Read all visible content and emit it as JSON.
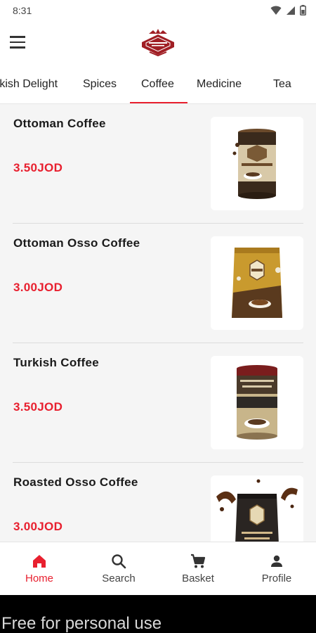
{
  "status_bar": {
    "time": "8:31"
  },
  "header": {
    "logo_icon": "brand-logo"
  },
  "tabs": [
    {
      "label": "rkish Delight"
    },
    {
      "label": "Spices"
    },
    {
      "label": "Coffee",
      "active": true
    },
    {
      "label": "Medicine"
    },
    {
      "label": "Tea"
    }
  ],
  "products": [
    {
      "name": "Ottoman Coffee",
      "price": "3.50JOD",
      "image_icon": "coffee-tin-icon"
    },
    {
      "name": "Ottoman Osso Coffee",
      "price": "3.00JOD",
      "image_icon": "coffee-pouch-icon"
    },
    {
      "name": "Turkish Coffee",
      "price": "3.50JOD",
      "image_icon": "coffee-tin-icon"
    },
    {
      "name": "Roasted Osso Coffee",
      "price": "3.00JOD",
      "image_icon": "coffee-pouch-icon"
    }
  ],
  "bottom_nav": [
    {
      "label": "Home",
      "icon": "home-icon",
      "active": true
    },
    {
      "label": "Search",
      "icon": "search-icon"
    },
    {
      "label": "Basket",
      "icon": "cart-icon"
    },
    {
      "label": "Profile",
      "icon": "person-icon"
    }
  ],
  "watermark": {
    "text": "Free for personal use"
  },
  "colors": {
    "accent": "#e8202f",
    "background": "#f5f5f5",
    "logo": "#a01e24"
  }
}
